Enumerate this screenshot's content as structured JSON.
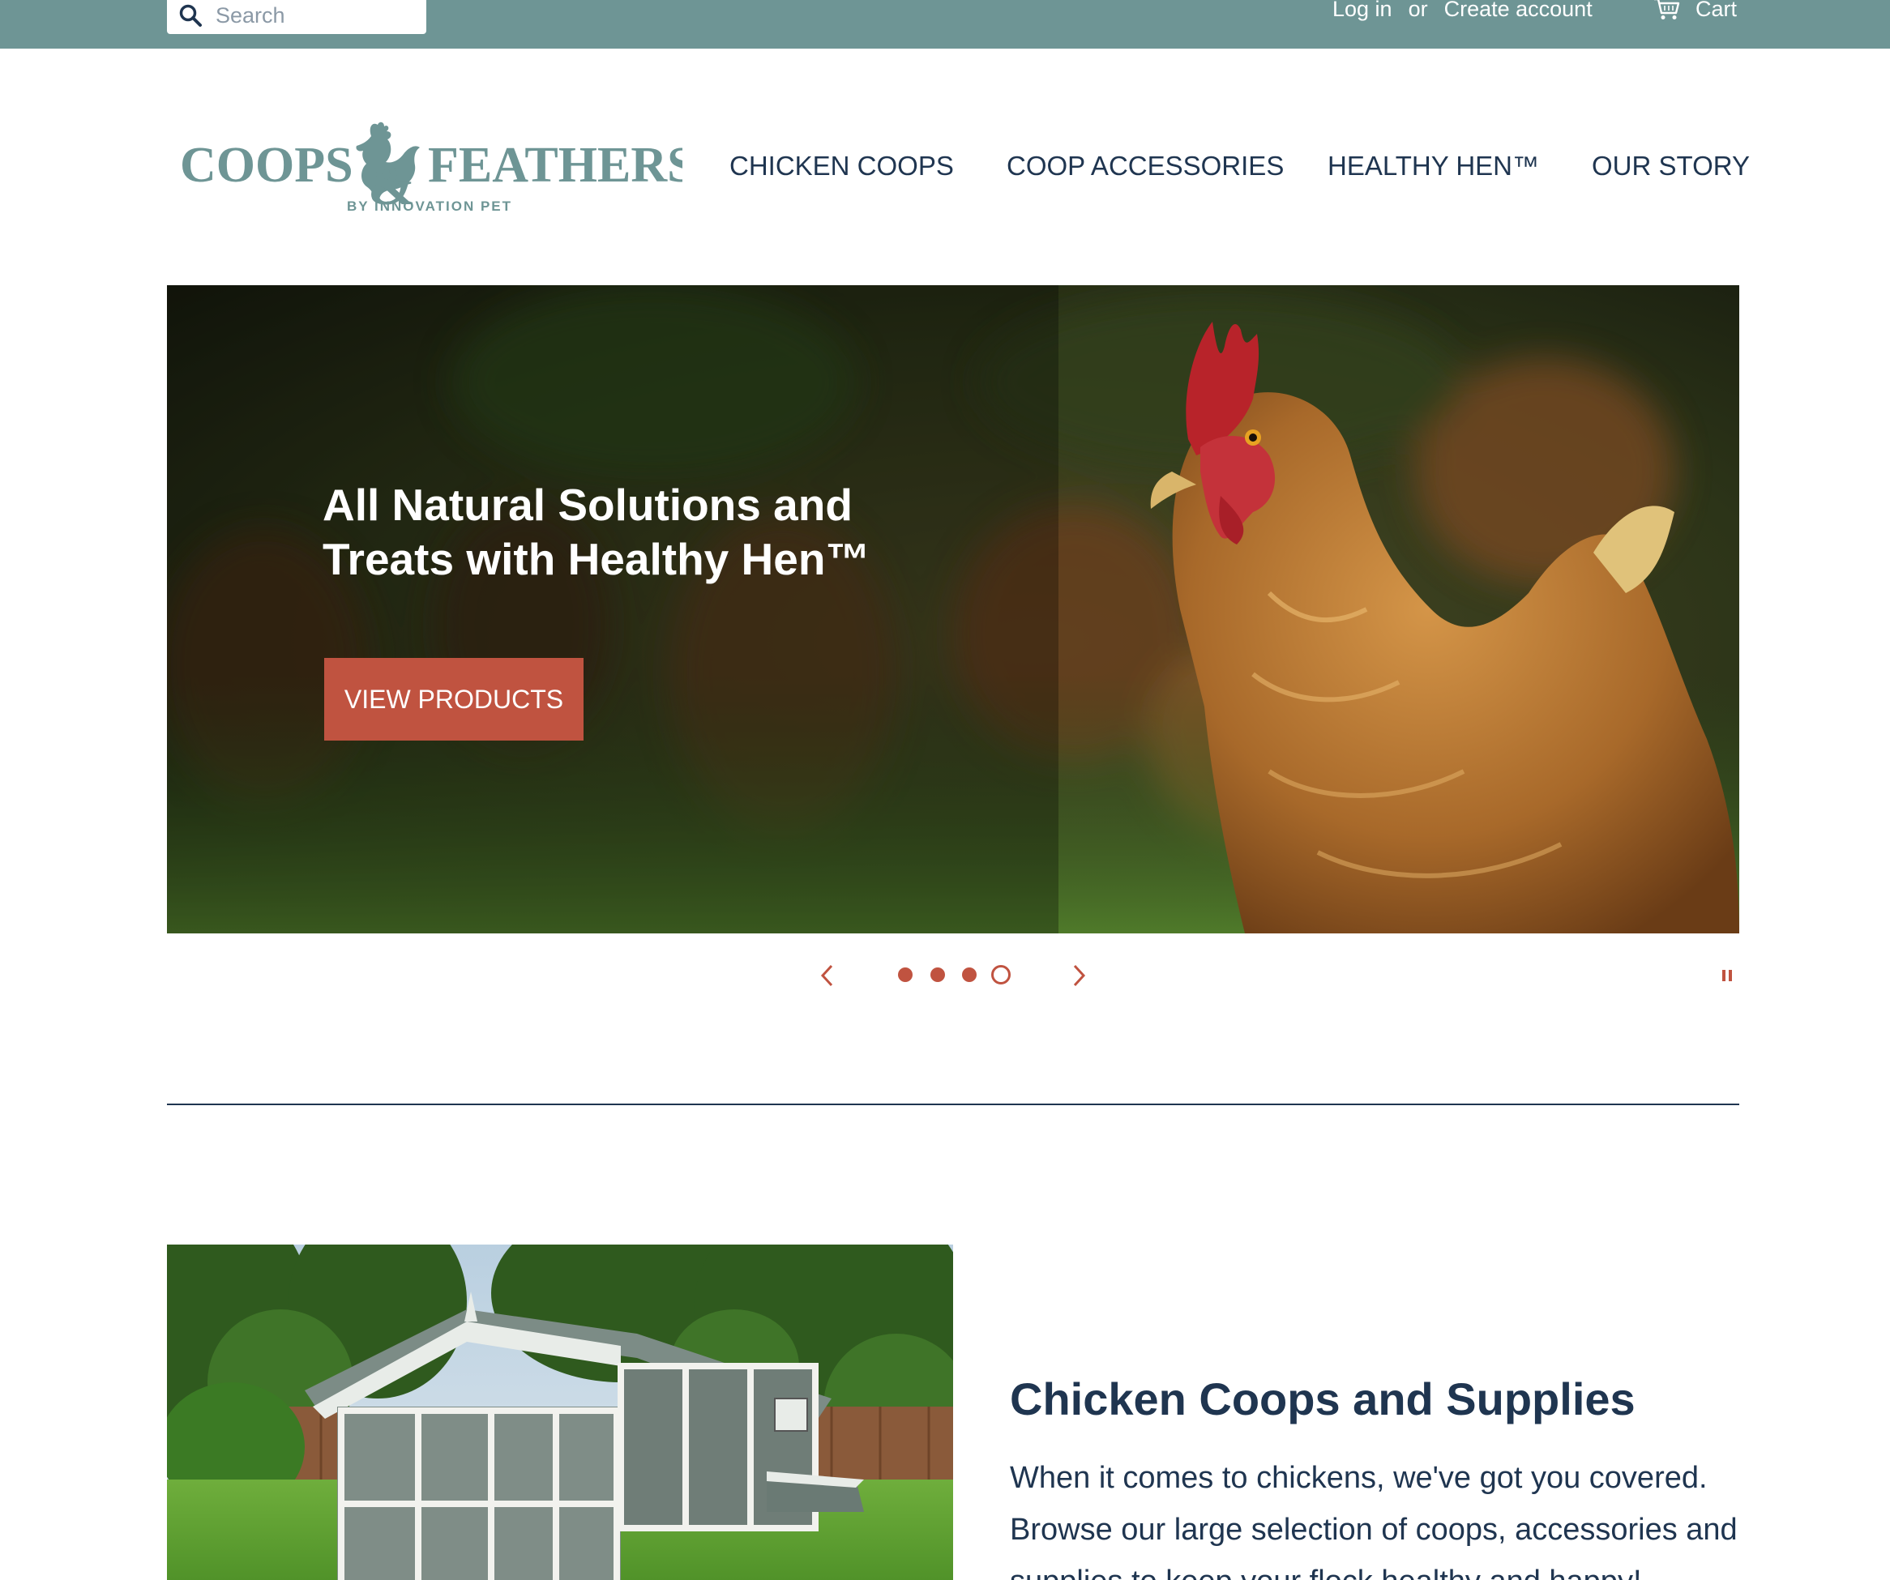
{
  "topbar": {
    "search_placeholder": "Search",
    "login": "Log in",
    "or": "or",
    "create_account": "Create account",
    "cart": "Cart"
  },
  "brand": {
    "logo_word_1": "COOPS",
    "logo_ampersand": "&",
    "logo_word_2": "FEATHERS",
    "logo_tagline": "BY INNOVATION PET",
    "color": "#6e9595"
  },
  "nav": {
    "items": [
      "CHICKEN COOPS",
      "COOP ACCESSORIES",
      "HEALTHY HEN™",
      "OUR STORY"
    ]
  },
  "hero": {
    "title": "All Natural Solutions and Treats with Healthy Hen™",
    "button": "VIEW PRODUCTS",
    "slide_count": 4,
    "active_slide": 4
  },
  "controls": {
    "prev_icon": "chevron-left-icon",
    "next_icon": "chevron-right-icon",
    "pause_icon": "pause-icon"
  },
  "feature": {
    "title": "Chicken Coops and Supplies",
    "text": "When it comes to chickens, we've got you covered. Browse our large selection of coops, accessories and supplies to keep your flock healthy and happy!"
  },
  "colors": {
    "topbar": "#6e9595",
    "accent": "#c05340",
    "text": "#1f3550"
  }
}
